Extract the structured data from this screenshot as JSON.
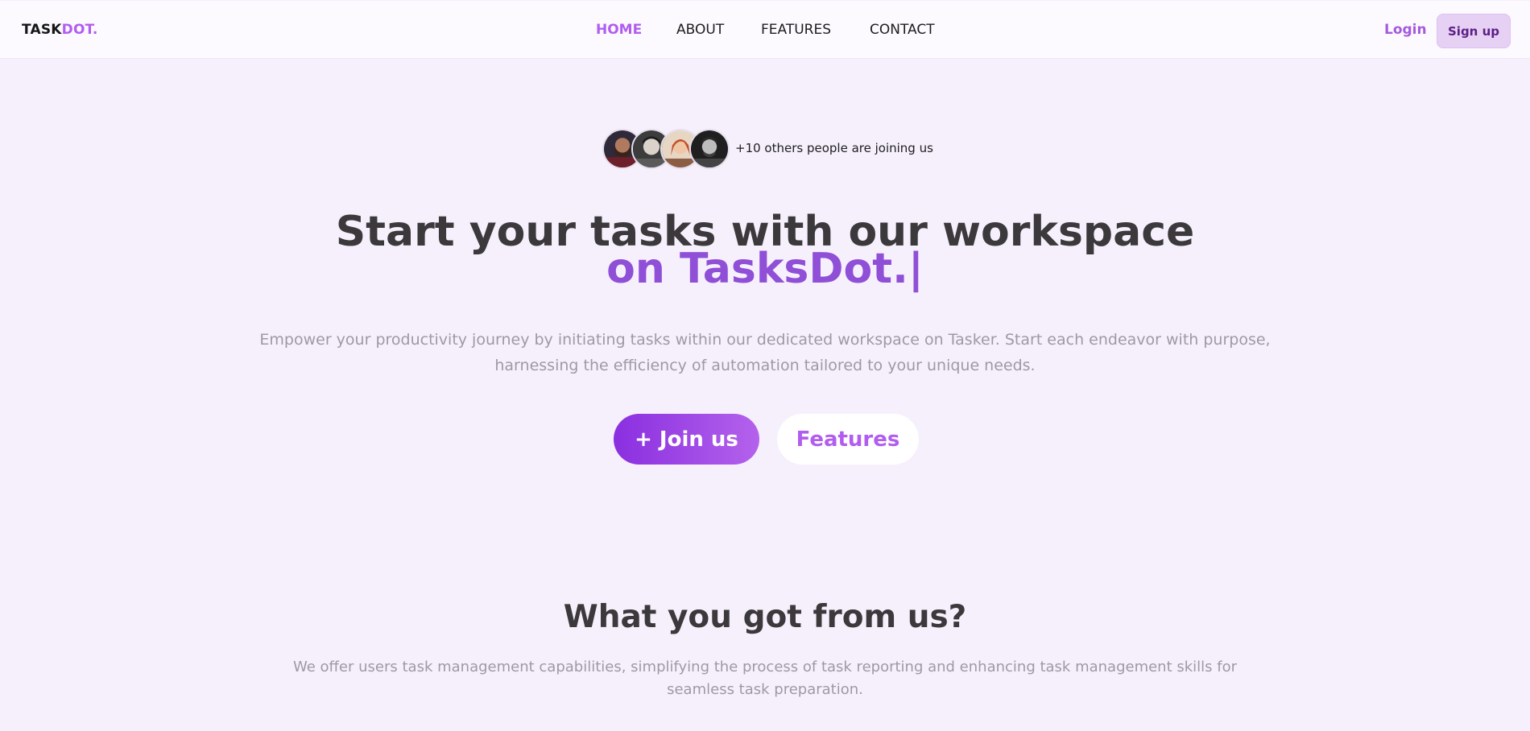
{
  "nav": {
    "logo_main": "TASK",
    "logo_accent": "DOT.",
    "links": [
      "HOME",
      "ABOUT",
      "FEATURES",
      "CONTACT"
    ],
    "active_link": "HOME",
    "login_label": "Login",
    "signup_label": "Sign up"
  },
  "hero": {
    "avatars": [
      "avatar-1",
      "avatar-2",
      "avatar-3",
      "avatar-4"
    ],
    "joining_text": "+10 others people are joining us",
    "title_line1": "Start your tasks with our workspace",
    "title_line2": "on TasksDot.|",
    "description": "Empower your productivity journey by initiating tasks within our dedicated workspace on Tasker. Start each endeavor with purpose, harnessing the efficiency of automation tailored to your unique needs.",
    "join_label": "+ Join us",
    "features_label": "Features"
  },
  "section": {
    "title": "What you got from us?",
    "description": "We offer users task management capabilities, simplifying the process of task reporting and enhancing task management skills for seamless task preparation."
  },
  "colors": {
    "accent": "#b15df0",
    "accent_dark": "#8f4fd6",
    "background": "#f6f0fd",
    "heading": "#3b393b",
    "muted_text": "#9d9aa3"
  }
}
